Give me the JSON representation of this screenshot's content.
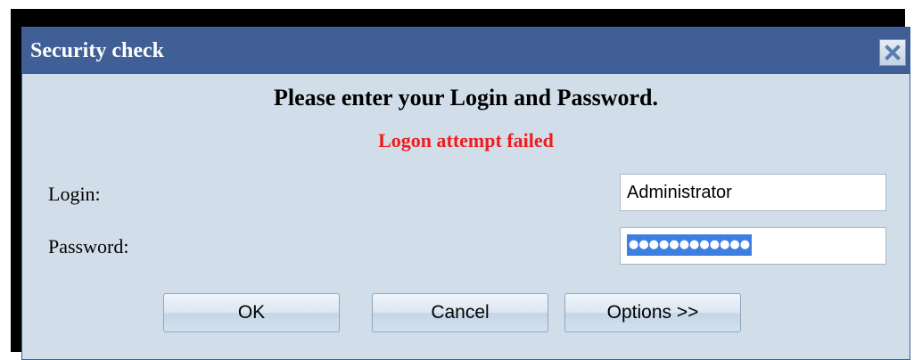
{
  "window": {
    "title": "Security check"
  },
  "dialog": {
    "heading": "Please enter your Login and Password.",
    "error": "Logon attempt failed",
    "login_label": "Login:",
    "login_value": "Administrator",
    "password_label": "Password:",
    "password_mask": "●●●●●●●●●●●●"
  },
  "buttons": {
    "ok": "OK",
    "cancel": "Cancel",
    "options": "Options >>"
  },
  "icons": {
    "close": "close-icon"
  },
  "colors": {
    "titlebar": "#3f5f96",
    "body": "#d1dee9",
    "error": "#ee1c1c",
    "selection": "#3d7fe0"
  }
}
